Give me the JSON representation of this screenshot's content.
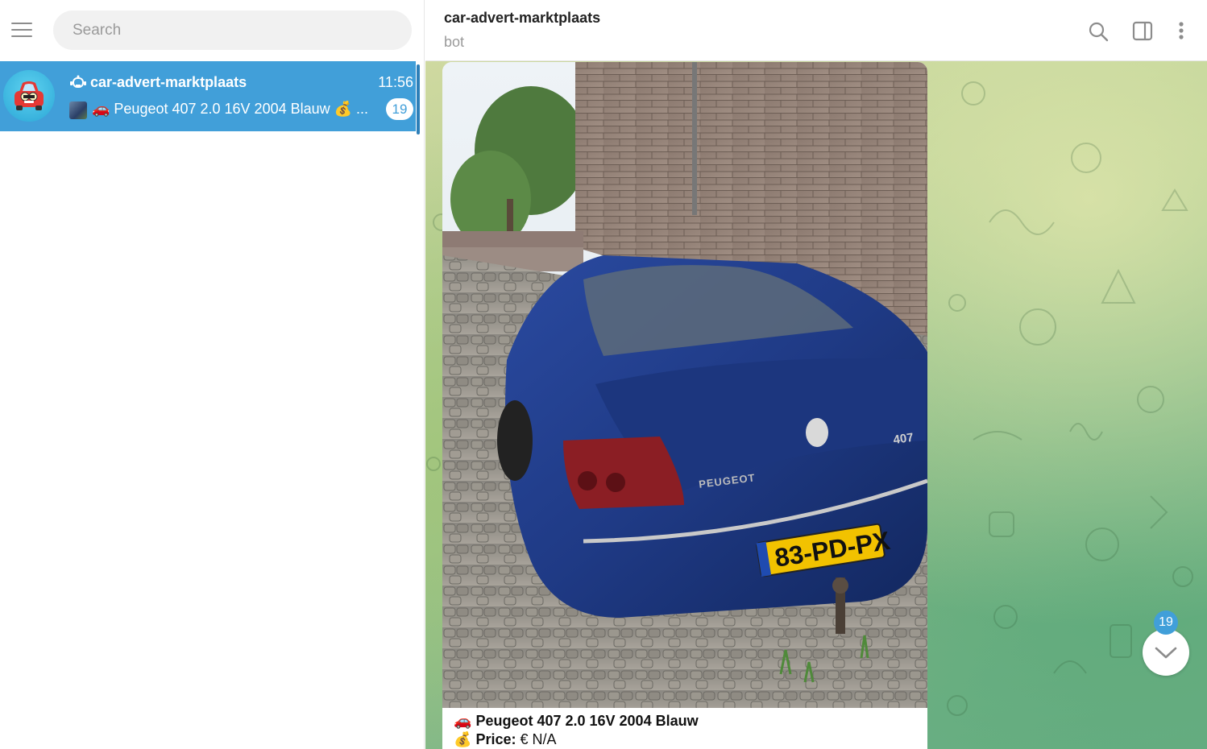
{
  "sidebar": {
    "search": {
      "placeholder": "Search"
    },
    "chats": [
      {
        "name": "car-advert-marktplaats",
        "time": "11:56",
        "preview": "🚗 Peugeot 407 2.0 16V 2004 Blauw 💰 ...",
        "unread": "19",
        "avatar": "car-emoji-avatar",
        "type_icon": "bot-icon"
      }
    ]
  },
  "chat": {
    "title": "car-advert-marktplaats",
    "status": "bot",
    "header_icons": [
      "search-icon",
      "sidebar-toggle-icon",
      "more-vertical-icon"
    ],
    "messages": [
      {
        "photo": "photo-blue-peugeot-407-rear",
        "plate": "83-PD-PX",
        "badge": "407",
        "brand": "PEUGEOT",
        "caption": [
          {
            "emoji": "🚗",
            "bold": "Peugeot 407 2.0 16V 2004 Blauw",
            "text": ""
          },
          {
            "emoji": "💰",
            "bold": "Price:",
            "text": " € N/A"
          }
        ]
      }
    ],
    "scroll_down_badge": "19"
  },
  "colors": {
    "accent": "#419fd9",
    "selected_chat_bg": "#419fd9",
    "chat_bg_top": "#cfd9a0",
    "chat_bg_bottom": "#6aaf86"
  }
}
